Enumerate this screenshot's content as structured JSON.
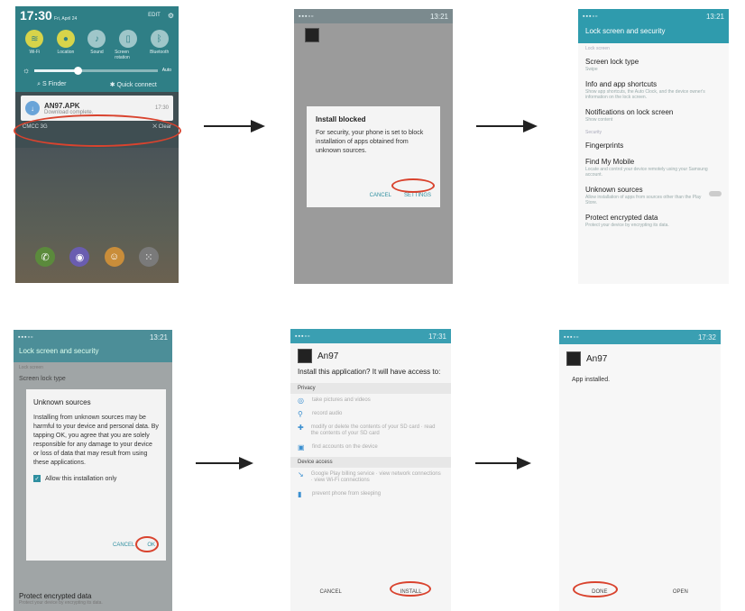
{
  "screen1": {
    "time": "17:30",
    "date": "Fri, April 24",
    "edit": "EDIT",
    "quick_settings": [
      {
        "label": "Wi-Fi",
        "icon": "wifi-icon",
        "glyph": "≋",
        "on": true
      },
      {
        "label": "Location",
        "icon": "location-icon",
        "glyph": "●",
        "on": true
      },
      {
        "label": "Sound",
        "icon": "sound-icon",
        "glyph": "♪",
        "on": false
      },
      {
        "label": "Screen rotation",
        "icon": "rotation-icon",
        "glyph": "▯",
        "on": false
      },
      {
        "label": "Bluetooth",
        "icon": "bluetooth-icon",
        "glyph": "ᛒ",
        "on": false
      }
    ],
    "auto_label": "Auto",
    "s_finder": "S Finder",
    "quick_connect": "Quick connect",
    "notification": {
      "title": "AN97.APK",
      "subtitle": "Download complete.",
      "time": "17:30"
    },
    "carrier": "CMCC 3G",
    "clear": "Clear",
    "brightness_level": 0.35,
    "dock_apps": [
      {
        "name": "phone-app-icon",
        "glyph": "✆",
        "color": "#5b8a3c"
      },
      {
        "name": "browser-app-icon",
        "glyph": "◉",
        "color": "#6a5db0"
      },
      {
        "name": "contacts-app-icon",
        "glyph": "☺",
        "color": "#c98d3a"
      },
      {
        "name": "apps-app-icon",
        "glyph": "⁙",
        "color": "#7a7a7a"
      }
    ]
  },
  "screen2": {
    "status_time": "13:21",
    "dialog_title": "Install blocked",
    "dialog_body": "For security, your phone is set to block installation of apps obtained from unknown sources.",
    "cancel": "CANCEL",
    "settings": "SETTINGS"
  },
  "screen3": {
    "status_time": "13:21",
    "title": "Lock screen and security",
    "section1": "Lock screen",
    "section2": "Security",
    "items": [
      {
        "title": "Screen lock type",
        "sub": "Swipe",
        "toggle": false
      },
      {
        "title": "Info and app shortcuts",
        "sub": "Show app shortcuts, the Auto Clock, and the device owner's information on the lock screen.",
        "toggle": false
      },
      {
        "title": "Notifications on lock screen",
        "sub": "Show content",
        "toggle": false
      },
      {
        "title": "Fingerprints",
        "sub": "",
        "toggle": false
      },
      {
        "title": "Find My Mobile",
        "sub": "Locate and control your device remotely using your Samsung account.",
        "toggle": false
      },
      {
        "title": "Unknown sources",
        "sub": "Allow installation of apps from sources other than the Play Store.",
        "toggle": true
      },
      {
        "title": "Protect encrypted data",
        "sub": "Protect your device by encrypting its data.",
        "toggle": false
      }
    ]
  },
  "screen4": {
    "status_time": "13:21",
    "header": "Lock screen and security",
    "bg_section": "Lock screen",
    "bg_item": "Screen lock type",
    "dialog_title": "Unknown sources",
    "dialog_body": "Installing from unknown sources may be harmful to your device and personal data. By tapping OK, you agree that you are solely responsible for any damage to your device or loss of data that may result from using these applications.",
    "checkbox_label": "Allow this installation only",
    "cancel": "CANCEL",
    "ok": "OK",
    "footer_title": "Protect encrypted data",
    "footer_sub": "Protect your device by encrypting its data."
  },
  "screen5": {
    "status_time": "17:31",
    "app_name": "An97",
    "question": "Install this application? It will have access to:",
    "privacy": "Privacy",
    "privacy_perms": [
      {
        "icon": "camera-icon",
        "glyph": "◎",
        "text": "take pictures and videos"
      },
      {
        "icon": "microphone-icon",
        "glyph": "⚲",
        "text": "record audio"
      },
      {
        "icon": "storage-icon",
        "glyph": "✚",
        "text": "modify or delete the contents of your SD card · read the contents of your SD card"
      },
      {
        "icon": "accounts-icon",
        "glyph": "▣",
        "text": "find accounts on the device"
      }
    ],
    "device_access": "Device access",
    "device_perms": [
      {
        "icon": "billing-icon",
        "glyph": "↘",
        "text": "Google Play billing service · view network connections · view Wi-Fi connections"
      },
      {
        "icon": "battery-icon",
        "glyph": "▮",
        "text": "prevent phone from sleeping"
      }
    ],
    "cancel": "CANCEL",
    "install": "INSTALL"
  },
  "screen6": {
    "status_time": "17:32",
    "app_name": "An97",
    "message": "App installed.",
    "done": "DONE",
    "open": "OPEN"
  }
}
